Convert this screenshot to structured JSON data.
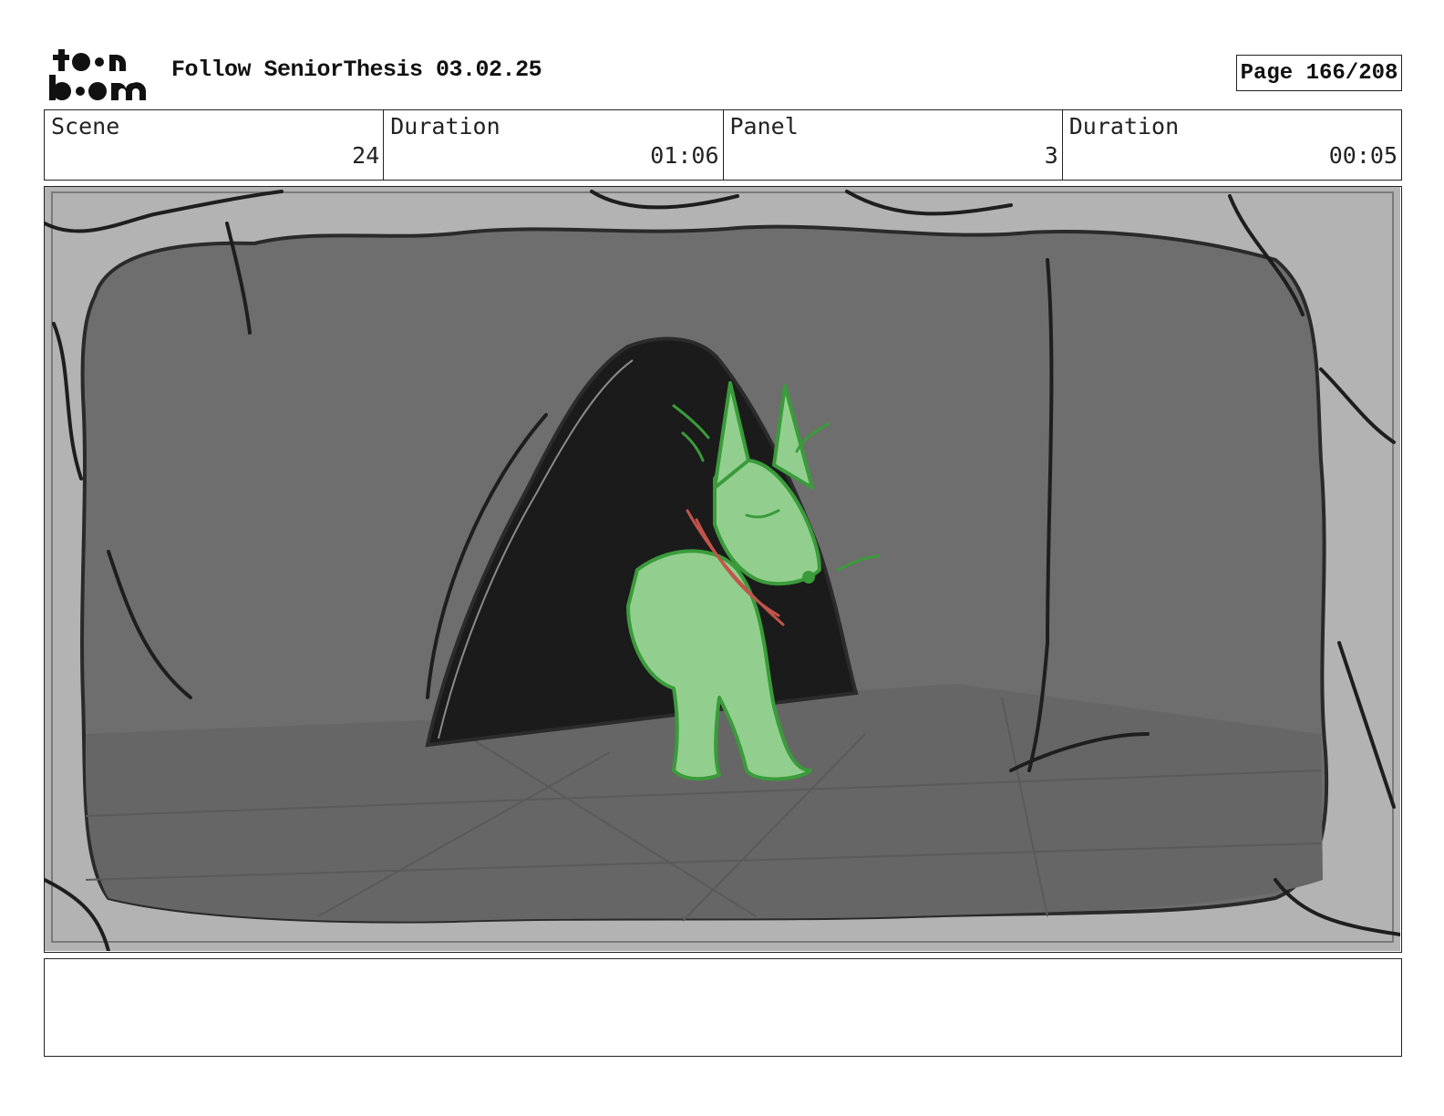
{
  "header": {
    "logo_text": "toon boom",
    "title": "Follow SeniorThesis 03.02.25",
    "page": "Page 166/208"
  },
  "info": {
    "scene_label": "Scene",
    "scene_value": "24",
    "scene_duration_label": "Duration",
    "scene_duration_value": "01:06",
    "panel_label": "Panel",
    "panel_value": "3",
    "panel_duration_label": "Duration",
    "panel_duration_value": "00:05"
  },
  "panel": {
    "colors": {
      "outer_rock": "#b3b3b3",
      "cave_wall": "#6e6e6e",
      "cave_floor": "#666666",
      "tunnel": "#1b1b1b",
      "character_fill": "#92cf8e",
      "character_line": "#3a9b3a",
      "collar_line": "#c2554b"
    }
  },
  "notes": {
    "text": ""
  }
}
